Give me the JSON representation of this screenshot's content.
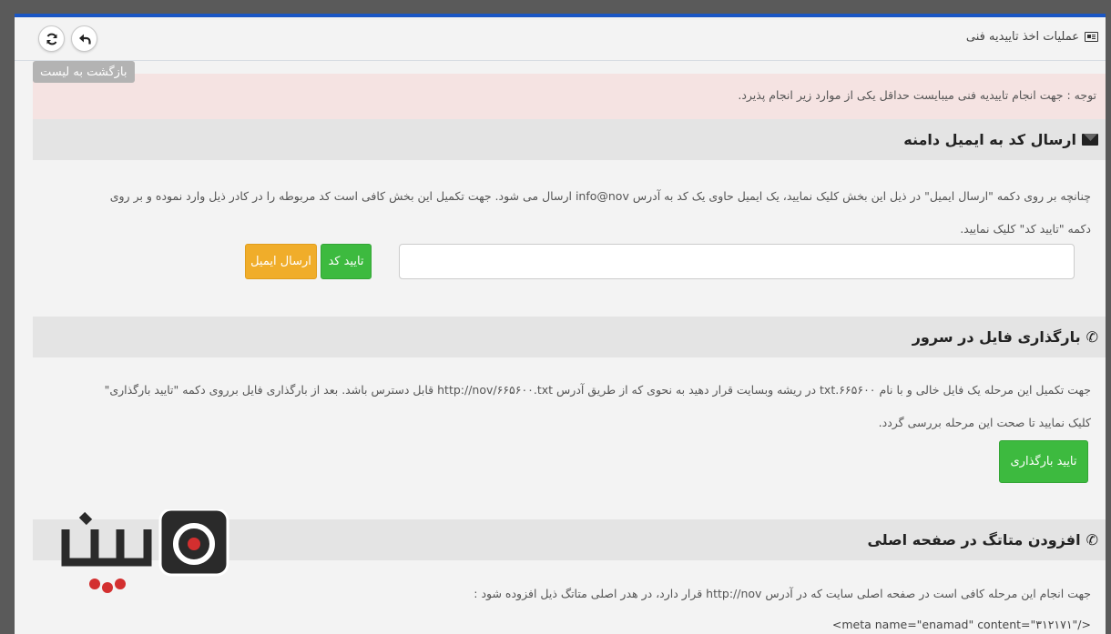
{
  "header": {
    "title": "عملیات اخذ تاییدیه فنی",
    "tooltip": "بازگشت به لیست"
  },
  "alert": {
    "text": "توجه : جهت انجام تاییدیه فنی میبایست حداقل یکی از موارد زیر انجام پذیرد."
  },
  "email_section": {
    "title": "ارسال کد به ایمیل دامنه",
    "line1": "چنانچه بر روی دکمه \"ارسال ایمیل\" در ذیل این بخش کلیک نمایید، یک ایمیل حاوی یک کد به آدرس info@nov ارسال می شود. جهت تکمیل این بخش کافی است کد مربوطه را در کادر ذیل وارد نموده و بر روی",
    "line2": "دکمه \"تایید کد\" کلیک نمایید.",
    "verify_label": "تایید کد",
    "send_label": "ارسال ایمیل"
  },
  "upload_section": {
    "title": "بارگذاری فایل در سرور",
    "line1": "جهت تکمیل این مرحله یک فایل خالی و با نام ۶۶۵۶۰۰.txt در ریشه وبسایت قرار دهید به نحوی که از طریق آدرس http://nov/۶۶۵۶۰۰.txt قابل دسترس باشد. بعد از بارگذاری فایل برروی دکمه \"تایید بارگذاری\"",
    "line2": "کلیک نمایید تا صحت این مرحله بررسی گردد.",
    "upload_label": "تایید بارگذاری"
  },
  "metatag_section": {
    "title": "افزودن متاتگ در صفحه اصلی",
    "line1": "جهت انجام این مرحله کافی است در صفحه اصلی سایت که در آدرس http://nov قرار دارد، در هدر اصلی متاتگ ذیل افزوده شود :",
    "code": "<meta name=\"enamad\" content=\"۳۱۲۱۷۱\"/>"
  },
  "icons": {
    "header": "id-card-icon",
    "refresh": "refresh-icon",
    "back": "reply-arrow-icon",
    "email": "envelope-icon",
    "upload": "phone-icon",
    "metatag": "phone-icon"
  },
  "colors": {
    "accent_top": "#1a56c4",
    "alert_bg": "#f5e3e2",
    "success": "#3dba3f",
    "warning": "#f0ad2a"
  }
}
